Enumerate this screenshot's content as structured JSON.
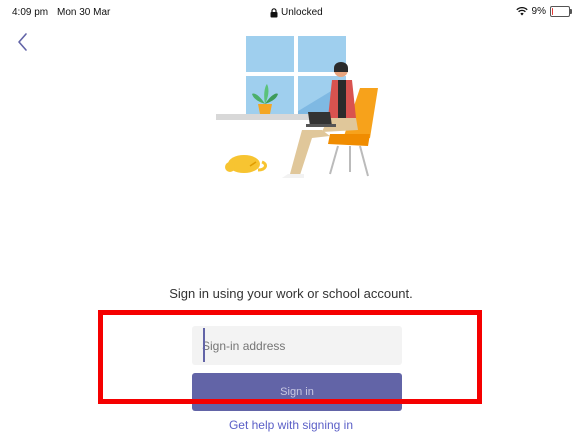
{
  "status_bar": {
    "time": "4:09 pm",
    "date": "Mon 30 Mar",
    "lock_status": "Unlocked",
    "battery": "9%",
    "battery_level": 0.09,
    "icons": [
      "lock-icon",
      "wifi-icon",
      "battery-icon"
    ]
  },
  "navigation": {
    "back_icon": "chevron-left-icon"
  },
  "illustration": {
    "subject": "person-working-on-laptop-in-chair"
  },
  "signin": {
    "prompt": "Sign in using your work or school account.",
    "address_placeholder": "Sign-in address",
    "button_label": "Sign in",
    "help_link": "Get help with signing in"
  },
  "colors": {
    "accent": "#6264a7",
    "link": "#5b5fc7",
    "highlight": "#f50000",
    "input_bg": "#f3f3f3"
  }
}
